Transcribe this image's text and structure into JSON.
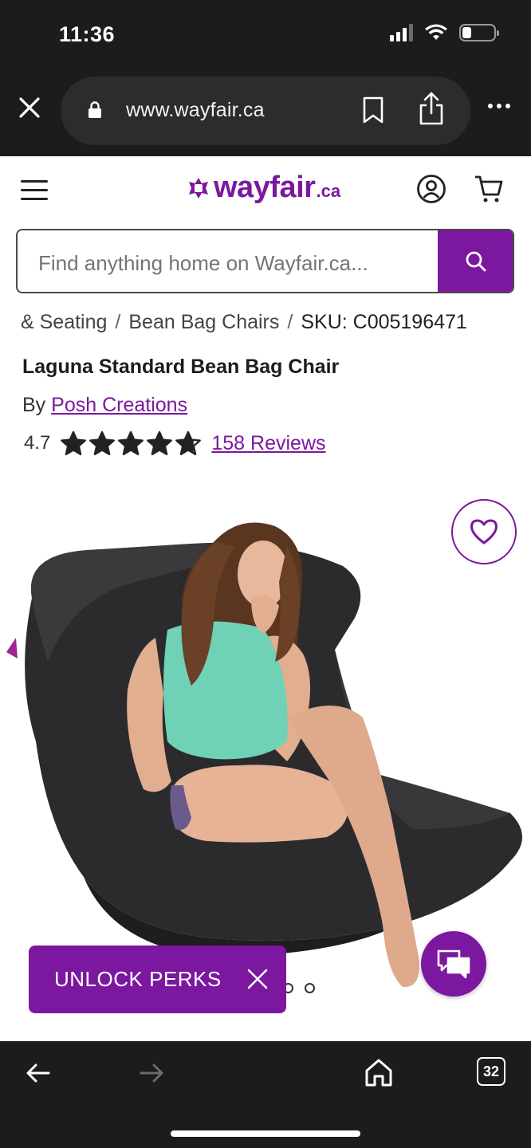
{
  "status_bar": {
    "time": "11:36",
    "battery_level": 0.3
  },
  "browser": {
    "url": "www.wayfair.ca",
    "tab_count": "32"
  },
  "header": {
    "logo_text": "wayfair",
    "logo_suffix": ".ca"
  },
  "search": {
    "placeholder": "Find anything home on Wayfair.ca..."
  },
  "breadcrumb": {
    "items": [
      "& Seating",
      "Bean Bag Chairs"
    ],
    "sku": "SKU: C005196471"
  },
  "product": {
    "title": "Laguna Standard Bean Bag Chair",
    "by_prefix": "By",
    "brand": "Posh Creations",
    "rating": "4.7",
    "rating_stars": 4.7,
    "reviews": "158 Reviews"
  },
  "promo": {
    "perks_label": "UNLOCK PERKS"
  },
  "carousel": {
    "dot_count": 2
  },
  "colors": {
    "brand": "#7b189f",
    "chrome": "#1c1c1e"
  }
}
